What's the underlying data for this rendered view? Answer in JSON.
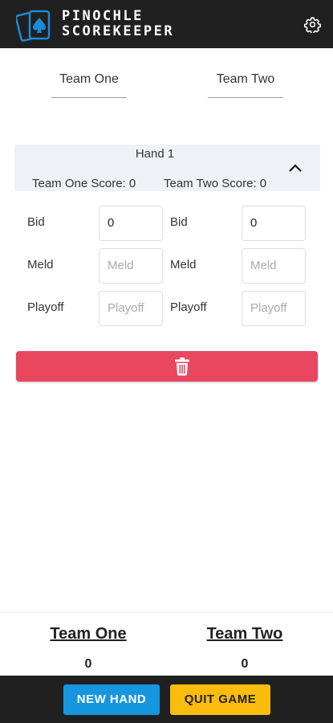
{
  "app": {
    "title_line1": "PINOCHLE",
    "title_line2": "SCOREKEEPER",
    "logo_icon": "playing-cards-spade-icon",
    "settings_icon": "gear-icon",
    "brand_color": "#1c8ad8"
  },
  "teams": {
    "team1_name": "Team One",
    "team2_name": "Team Two"
  },
  "hand": {
    "title": "Hand 1",
    "team1_score_text": "Team One Score: 0",
    "team2_score_text": "Team Two Score: 0",
    "toggle_icon": "chevron-up-icon",
    "team1": {
      "bid_label": "Bid",
      "bid_value": "0",
      "meld_label": "Meld",
      "meld_placeholder": "Meld",
      "playoff_label": "Playoff",
      "playoff_placeholder": "Playoff"
    },
    "team2": {
      "bid_label": "Bid",
      "bid_value": "0",
      "meld_label": "Meld",
      "meld_placeholder": "Meld",
      "playoff_label": "Playoff",
      "playoff_placeholder": "Playoff"
    },
    "delete_icon": "trash-icon",
    "delete_color": "#e8475f"
  },
  "totals": {
    "team1_name": "Team One",
    "team1_total": "0",
    "team2_name": "Team Two",
    "team2_total": "0"
  },
  "footer": {
    "new_hand_label": "NEW HAND",
    "new_hand_color": "#1596de",
    "quit_game_label": "QUIT GAME",
    "quit_game_color": "#fbbc0e"
  }
}
